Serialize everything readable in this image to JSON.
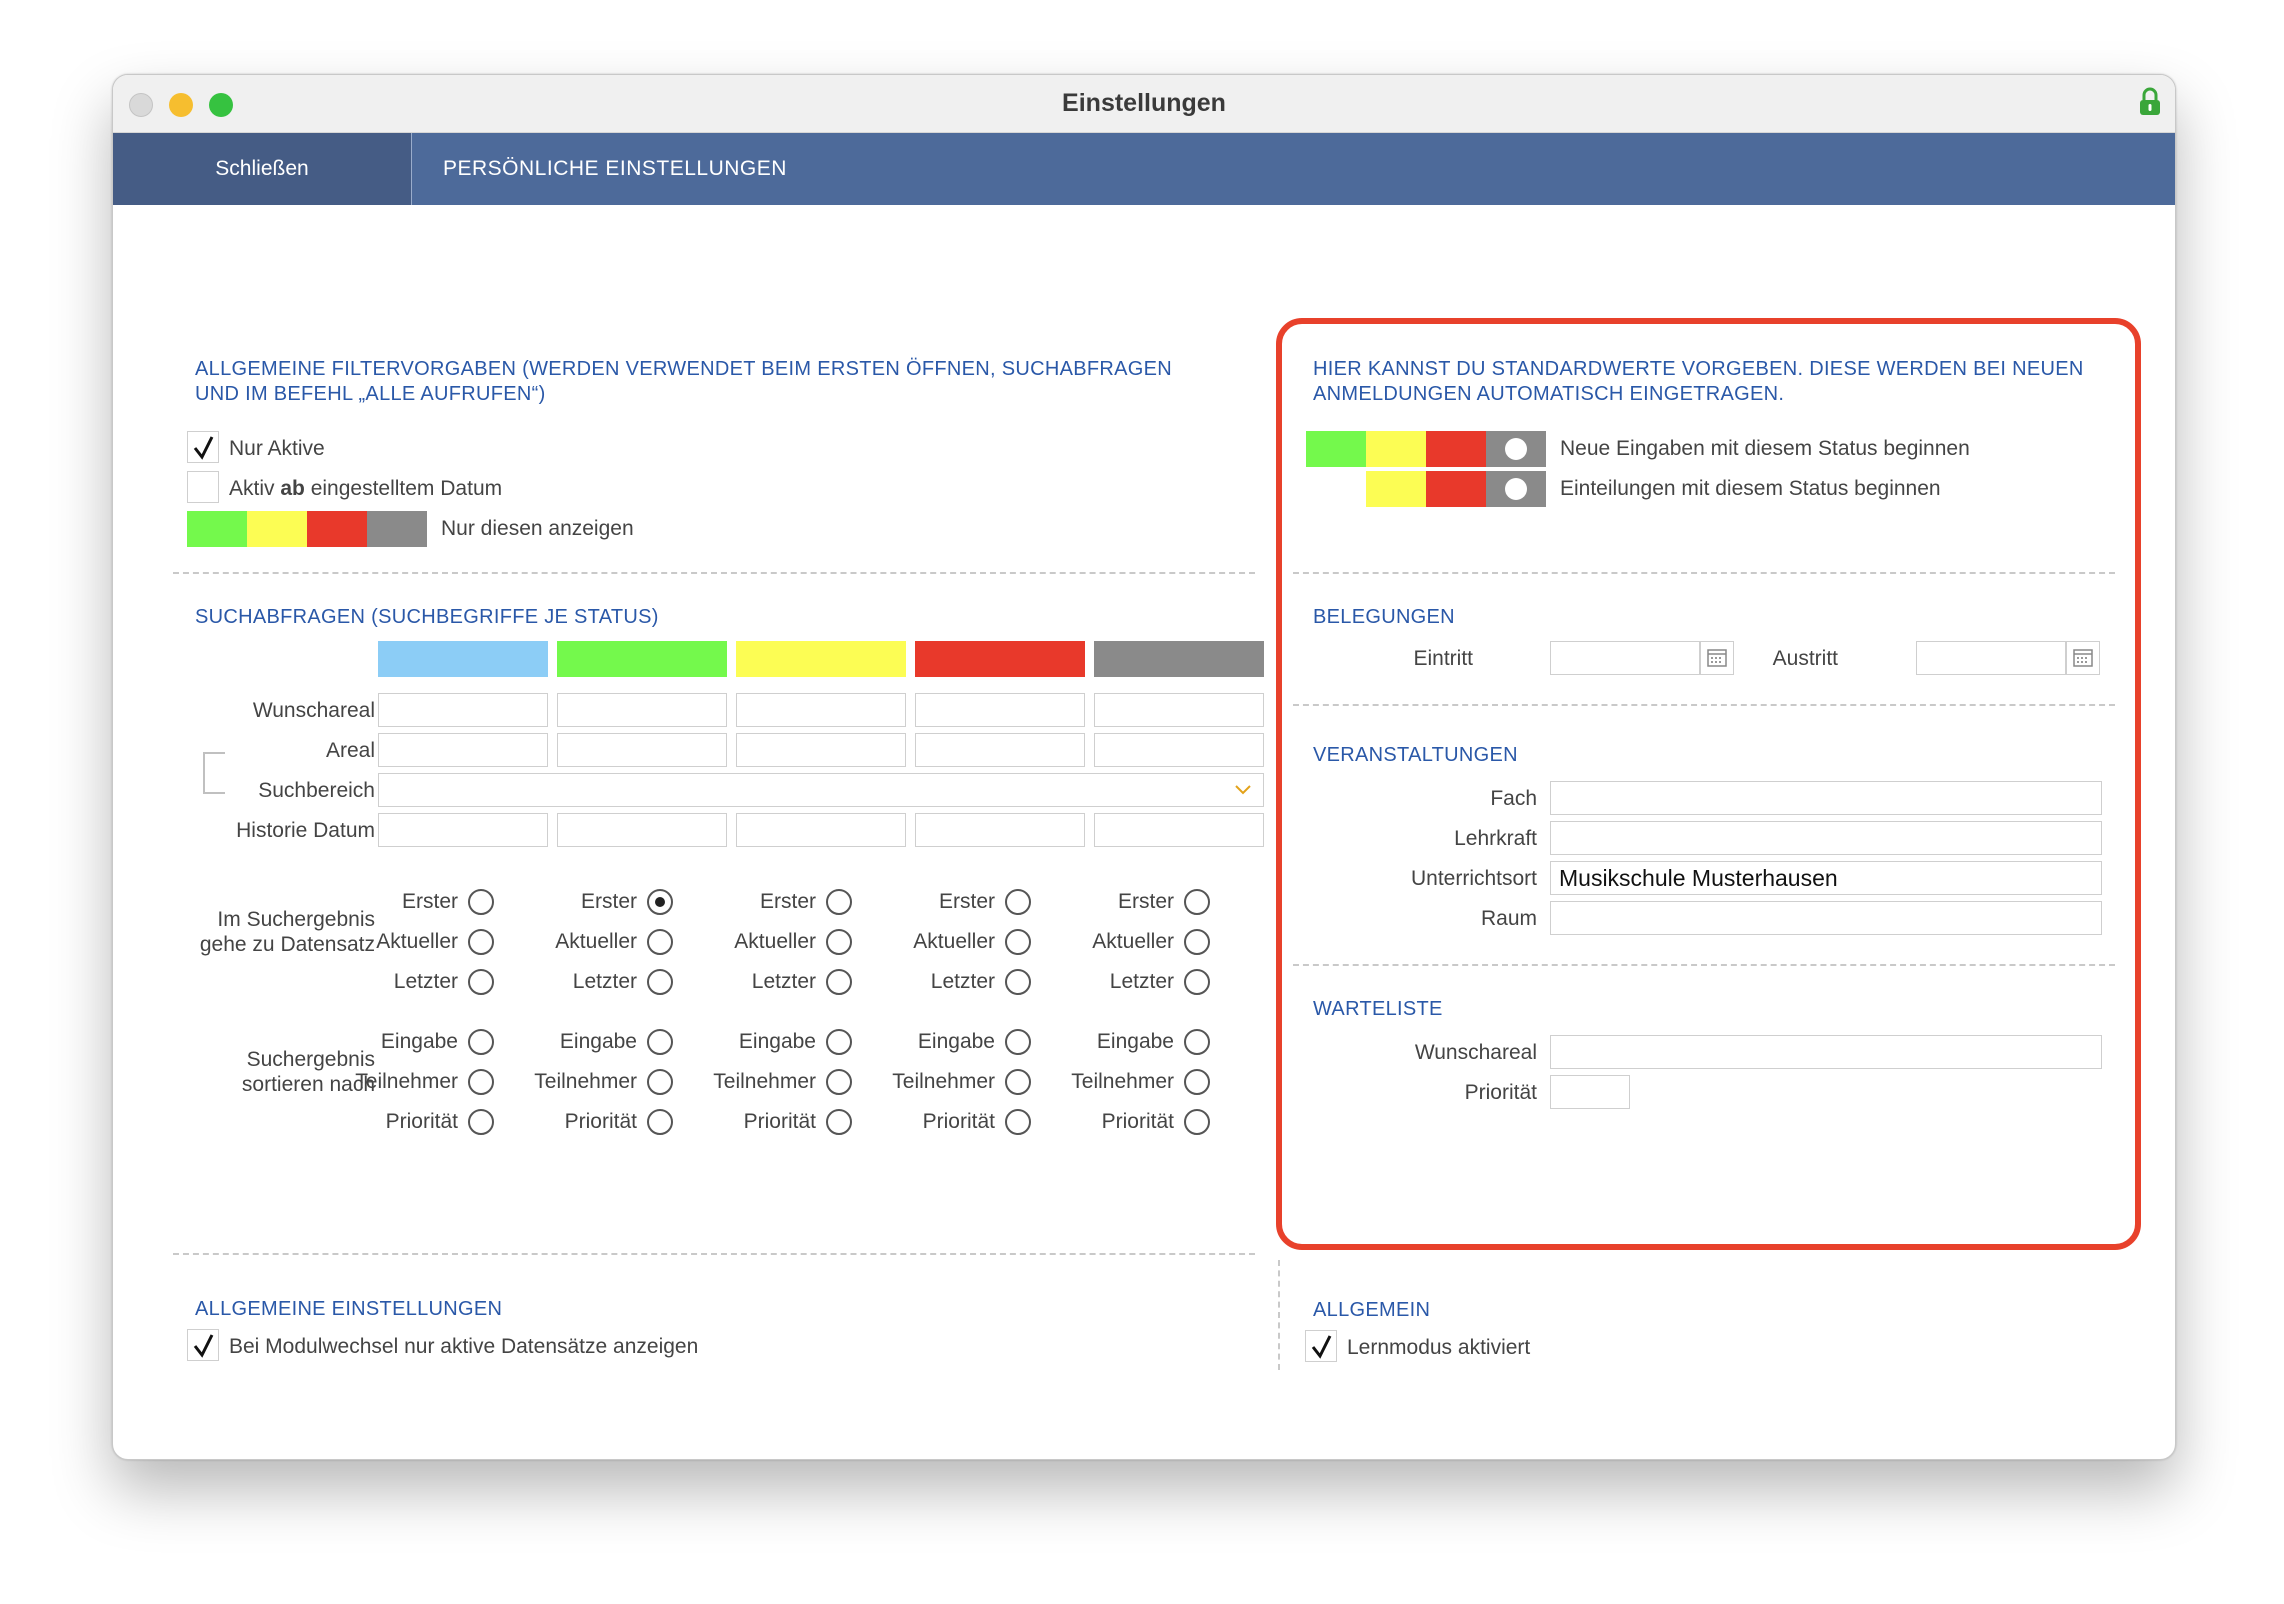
{
  "window": {
    "title": "Einstellungen"
  },
  "nav": {
    "close_label": "Schließen",
    "title": "PERSÖNLICHE EINSTELLUNGEN"
  },
  "colors": {
    "nav": "#4d6a9a",
    "accent_text": "#2a58a8",
    "highlight_frame": "#e8412b",
    "status_blue": "#8ccdf6",
    "status_green": "#74f94c",
    "status_yellow": "#fcfd54",
    "status_red": "#e8392b",
    "status_gray": "#8a8a8a"
  },
  "filter": {
    "heading": "ALLGEMEINE FILTERVORGABEN (WERDEN VERWENDET BEIM ERSTEN ÖFFNEN, SUCHABFRAGEN UND IM BEFEHL „ALLE AUFRUFEN“)",
    "only_active": {
      "label": "Nur Aktive",
      "checked": true
    },
    "active_from": {
      "label_pre": "Aktiv ",
      "label_bold": "ab",
      "label_post": " eingestelltem Datum",
      "checked": false
    },
    "show_only_label": "Nur diesen anzeigen"
  },
  "search": {
    "heading": "SUCHABFRAGEN (SUCHBEGRIFFE JE STATUS)",
    "status_columns": [
      "blue",
      "green",
      "yellow",
      "red",
      "gray"
    ],
    "rows": {
      "wunschareal": "Wunschareal",
      "areal": "Areal",
      "suchbereich": "Suchbereich",
      "historie": "Historie Datum"
    },
    "goto_label_1": "Im Suchergebnis",
    "goto_label_2": "gehe zu Datensatz",
    "goto_options": [
      "Erster",
      "Aktueller",
      "Letzter"
    ],
    "goto_selected_column": 1,
    "sort_label_1": "Suchergebnis",
    "sort_label_2": "sortieren nach",
    "sort_options": [
      "Eingabe",
      "Teilnehmer",
      "Priorität"
    ]
  },
  "defaults": {
    "heading": "HIER KANNST DU STANDARDWERTE VORGEBEN. DIESE WERDEN BEI NEUEN ANMELDUNGEN AUTOMATISCH EINGETRAGEN.",
    "new_entries_label": "Neue Eingaben mit diesem Status beginnen",
    "assignments_label": "Einteilungen mit diesem Status beginnen"
  },
  "belegungen": {
    "heading": "BELEGUNGEN",
    "eintritt_label": "Eintritt",
    "austritt_label": "Austritt",
    "eintritt_value": "",
    "austritt_value": ""
  },
  "veranstaltungen": {
    "heading": "VERANSTALTUNGEN",
    "fach_label": "Fach",
    "fach_value": "",
    "lehrkraft_label": "Lehrkraft",
    "lehrkraft_value": "",
    "unterrichtsort_label": "Unterrichtsort",
    "unterrichtsort_value": "Musikschule Musterhausen",
    "raum_label": "Raum",
    "raum_value": ""
  },
  "warteliste": {
    "heading": "WARTELISTE",
    "wunschareal_label": "Wunschareal",
    "wunschareal_value": "",
    "prioritaet_label": "Priorität",
    "prioritaet_value": ""
  },
  "general": {
    "heading": "ALLGEMEINE EINSTELLUNGEN",
    "module_switch_label": "Bei Modulwechsel nur aktive Datensätze anzeigen",
    "module_switch_checked": true
  },
  "allgemein": {
    "heading": "ALLGEMEIN",
    "learn_mode_label": "Lernmodus aktiviert",
    "learn_mode_checked": true
  }
}
